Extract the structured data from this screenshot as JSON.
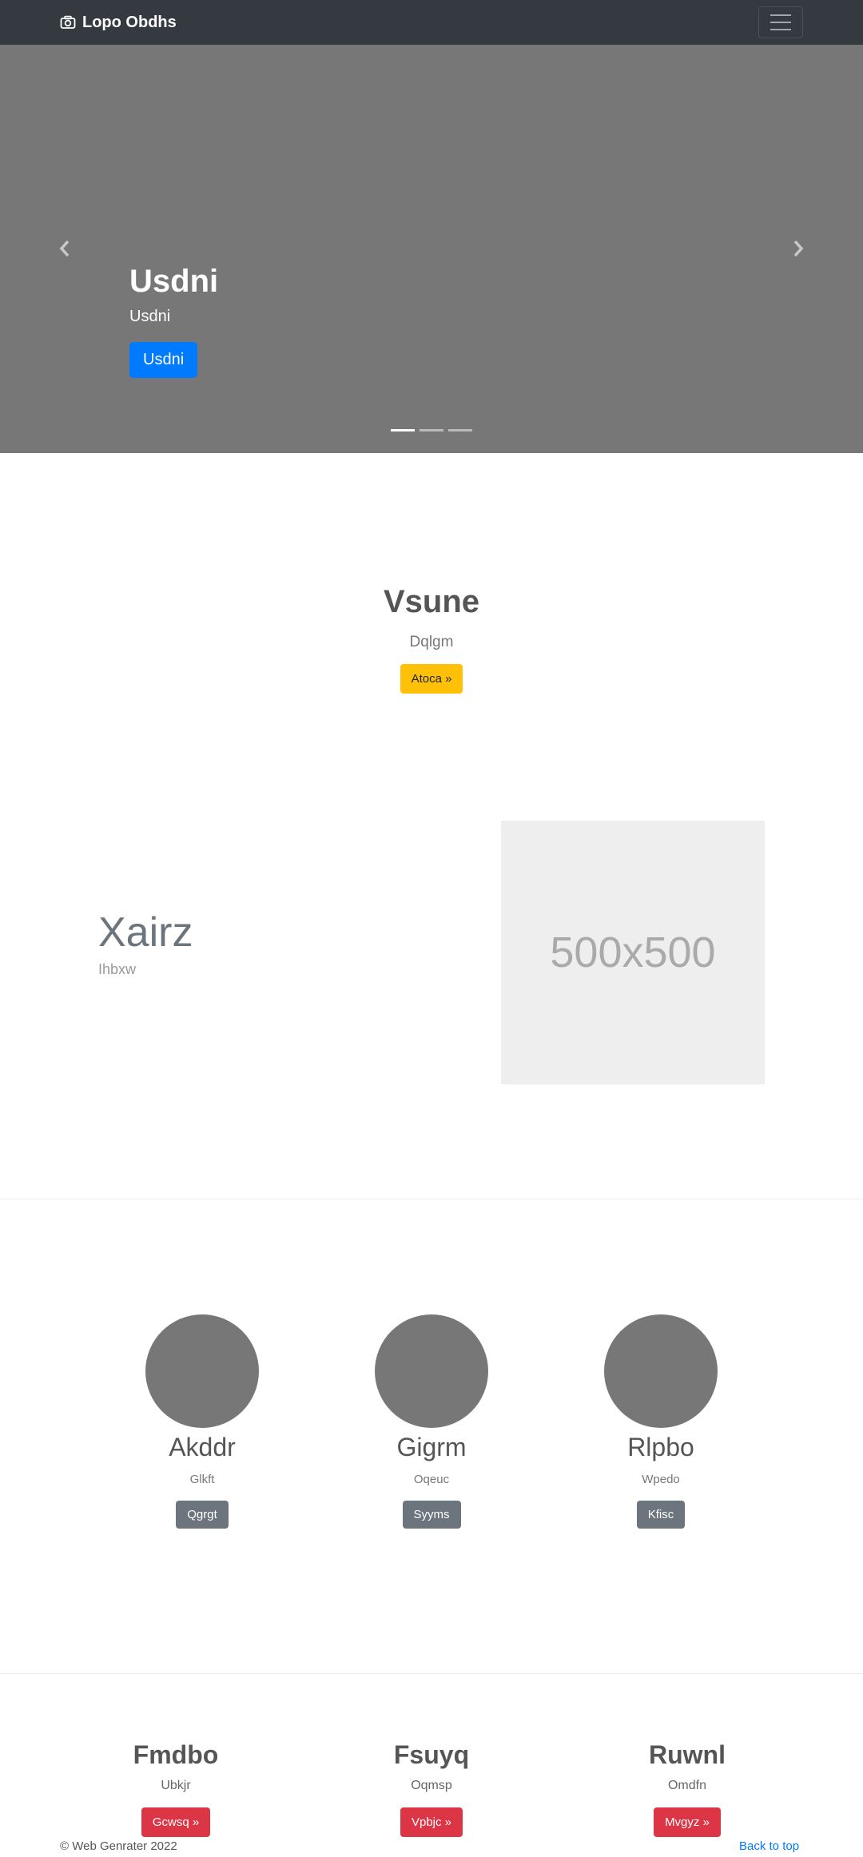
{
  "navbar": {
    "brand": "Lopo Obdhs"
  },
  "carousel": {
    "title": "Usdni",
    "text": "Usdni",
    "button": "Usdni",
    "slides": 3,
    "active_slide": 1
  },
  "hero": {
    "title": "Vsune",
    "subtitle": "Dqlgm",
    "button": "Atoca »"
  },
  "feature": {
    "title": "Xairz",
    "subtitle": "Ihbxw",
    "image_label": "500x500"
  },
  "circles": [
    {
      "title": "Akddr",
      "subtitle": "Glkft",
      "button": "Qgrgt"
    },
    {
      "title": "Gigrm",
      "subtitle": "Oqeuc",
      "button": "Syyms"
    },
    {
      "title": "Rlpbo",
      "subtitle": "Wpedo",
      "button": "Kfisc"
    }
  ],
  "bottom": [
    {
      "title": "Fmdbo",
      "subtitle": "Ubkjr",
      "button": "Gcwsq »"
    },
    {
      "title": "Fsuyq",
      "subtitle": "Oqmsp",
      "button": "Vpbjc »"
    },
    {
      "title": "Ruwnl",
      "subtitle": "Omdfn",
      "button": "Mvgyz »"
    }
  ],
  "footer": {
    "copyright": "© Web Genrater 2022",
    "back_to_top": "Back to top"
  },
  "colors": {
    "navbar": "#343a40",
    "carousel_bg": "#777777",
    "primary": "#007bff",
    "warning": "#ffc107",
    "secondary": "#6c757d",
    "danger": "#dc3545"
  }
}
